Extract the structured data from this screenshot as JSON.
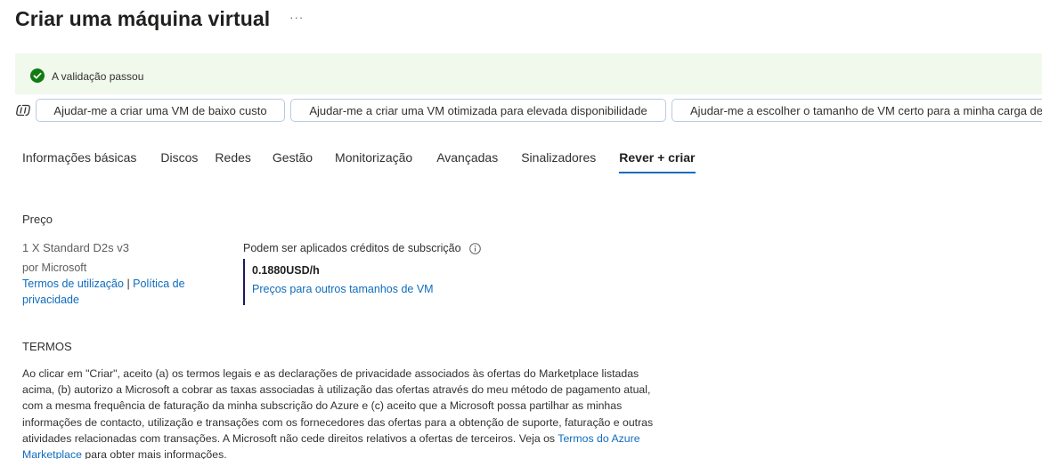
{
  "header": {
    "title": "Criar uma máquina virtual",
    "more_label": "···"
  },
  "banner": {
    "status_text": "A validação passou",
    "icon": "check-circle-icon",
    "color": "#107c10",
    "background": "#f1f8ec"
  },
  "copilot": {
    "icon": "copilot-icon",
    "suggestions": [
      "Ajudar-me a criar uma VM de baixo custo",
      "Ajudar-me a criar uma VM otimizada para elevada disponibilidade",
      "Ajudar-me a escolher o tamanho de VM certo para a minha carga de"
    ]
  },
  "tabs": [
    {
      "label": "Informações básicas"
    },
    {
      "label": "Discos"
    },
    {
      "label": "Redes"
    },
    {
      "label": "Gestão"
    },
    {
      "label": "Monitorização"
    },
    {
      "label": "Avançadas"
    },
    {
      "label": "Sinalizadores"
    },
    {
      "label": "Rever + criar",
      "active": true
    }
  ],
  "price": {
    "section_label": "Preço",
    "sku": "1 X Standard D2s v3",
    "publisher": "por Microsoft",
    "terms_link": "Termos de utilização",
    "separator": "|",
    "privacy_link": "Política de privacidade",
    "credits_note": "Podem ser aplicados créditos de subscrição",
    "value": "0.1880USD/h",
    "other_sizes_link": "Preços para outros tamanhos de VM"
  },
  "terms": {
    "section_label": "TERMOS",
    "body_before_link": "Ao clicar em \"Criar\", aceito (a) os termos legais e as declarações de privacidade associados às ofertas do Marketplace listadas acima, (b) autorizo a Microsoft a cobrar as taxas associadas à utilização das ofertas através do meu método de pagamento atual, com a mesma frequência de faturação da minha subscrição do Azure e (c) aceito que a Microsoft possa partilhar as minhas informações de contacto, utilização e transações com os fornecedores das ofertas para a obtenção de suporte, faturação e outras atividades relacionadas com transações. A Microsoft não cede direitos relativos a ofertas de terceiros. Veja os",
    "marketplace_link": "Termos do Azure Marketplace",
    "body_after_link": "para obter mais informações."
  },
  "colors": {
    "accent": "#0f6cbd",
    "price_bar": "#1b1a5c",
    "pill_border": "#b7cbe6"
  }
}
